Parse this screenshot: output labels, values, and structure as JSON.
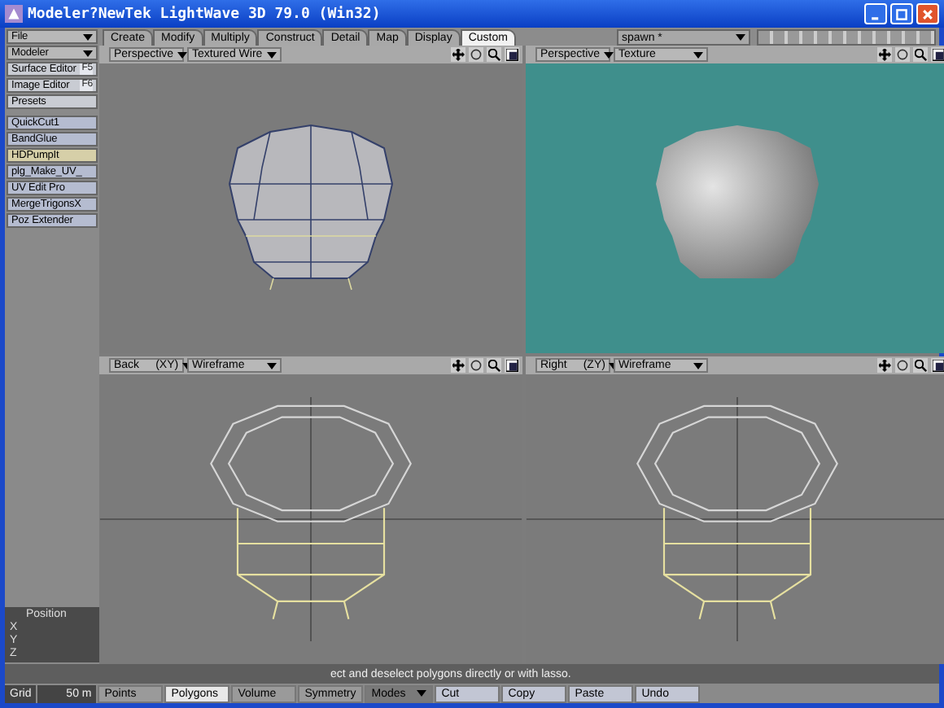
{
  "window": {
    "title": "Modeler?NewTek LightWave 3D 79.0 (Win32)"
  },
  "sidebar": {
    "dropdowns": [
      "File",
      "Modeler"
    ],
    "items": [
      {
        "label": "Surface Editor",
        "key": "F5"
      },
      {
        "label": "Image Editor",
        "key": "F6"
      },
      {
        "label": "Presets"
      }
    ],
    "plugins": [
      {
        "label": "QuickCut1",
        "selected": false
      },
      {
        "label": "BandGlue",
        "selected": false
      },
      {
        "label": "HDPumpIt",
        "selected": true
      },
      {
        "label": "plg_Make_UV_",
        "selected": false
      },
      {
        "label": "UV Edit Pro",
        "selected": false
      },
      {
        "label": "MergeTrigonsX",
        "selected": false
      },
      {
        "label": "Poz Extender",
        "selected": false
      }
    ]
  },
  "tabs": [
    {
      "label": "Create",
      "selected": false
    },
    {
      "label": "Modify",
      "selected": false
    },
    {
      "label": "Multiply",
      "selected": false
    },
    {
      "label": "Construct",
      "selected": false
    },
    {
      "label": "Detail",
      "selected": false
    },
    {
      "label": "Map",
      "selected": false
    },
    {
      "label": "Display",
      "selected": false
    },
    {
      "label": "Custom",
      "selected": true
    }
  ],
  "object_dropdown": "spawn *",
  "viewports": [
    {
      "view": "Perspective",
      "mode": "Textured Wire",
      "kind": "textured"
    },
    {
      "view": "Perspective",
      "mode": "Texture",
      "kind": "shaded"
    },
    {
      "view": "Back",
      "axis": "(XY)",
      "mode": "Wireframe",
      "kind": "wire"
    },
    {
      "view": "Right",
      "axis": "(ZY)",
      "mode": "Wireframe",
      "kind": "wire"
    }
  ],
  "position_panel": {
    "title": "Position",
    "axes": [
      "X",
      "Y",
      "Z"
    ]
  },
  "status_message": "ect and deselect polygons directly or with lasso.",
  "bottom_bar": {
    "grid_label": "Grid",
    "grid_value": "50 m",
    "selection_modes": [
      {
        "label": "Points",
        "selected": false
      },
      {
        "label": "Polygons",
        "selected": true
      },
      {
        "label": "Volume",
        "selected": false
      }
    ],
    "symmetry": "Symmetry",
    "modes": "Modes",
    "actions": [
      "Cut",
      "Copy",
      "Paste",
      "Undo"
    ]
  }
}
